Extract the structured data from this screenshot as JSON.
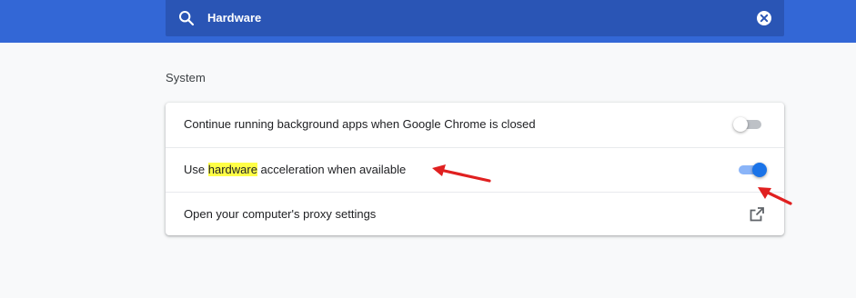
{
  "search": {
    "value": "Hardware",
    "icon": "search-icon",
    "clear_icon": "clear-icon"
  },
  "section": {
    "title": "System"
  },
  "settings": [
    {
      "label": "Continue running background apps when Google Chrome is closed",
      "control": "toggle",
      "enabled": false
    },
    {
      "label_before": "Use ",
      "label_highlight": "hardware",
      "label_after": " acceleration when available",
      "control": "toggle",
      "enabled": true
    },
    {
      "label": "Open your computer's proxy settings",
      "control": "external-link",
      "icon": "external-link-icon"
    }
  ],
  "colors": {
    "header": "#3367d6",
    "search_bar": "#2a55b5",
    "toggle_on": "#1a73e8",
    "highlight": "#ffff47",
    "annotation_arrow": "#e02020"
  }
}
